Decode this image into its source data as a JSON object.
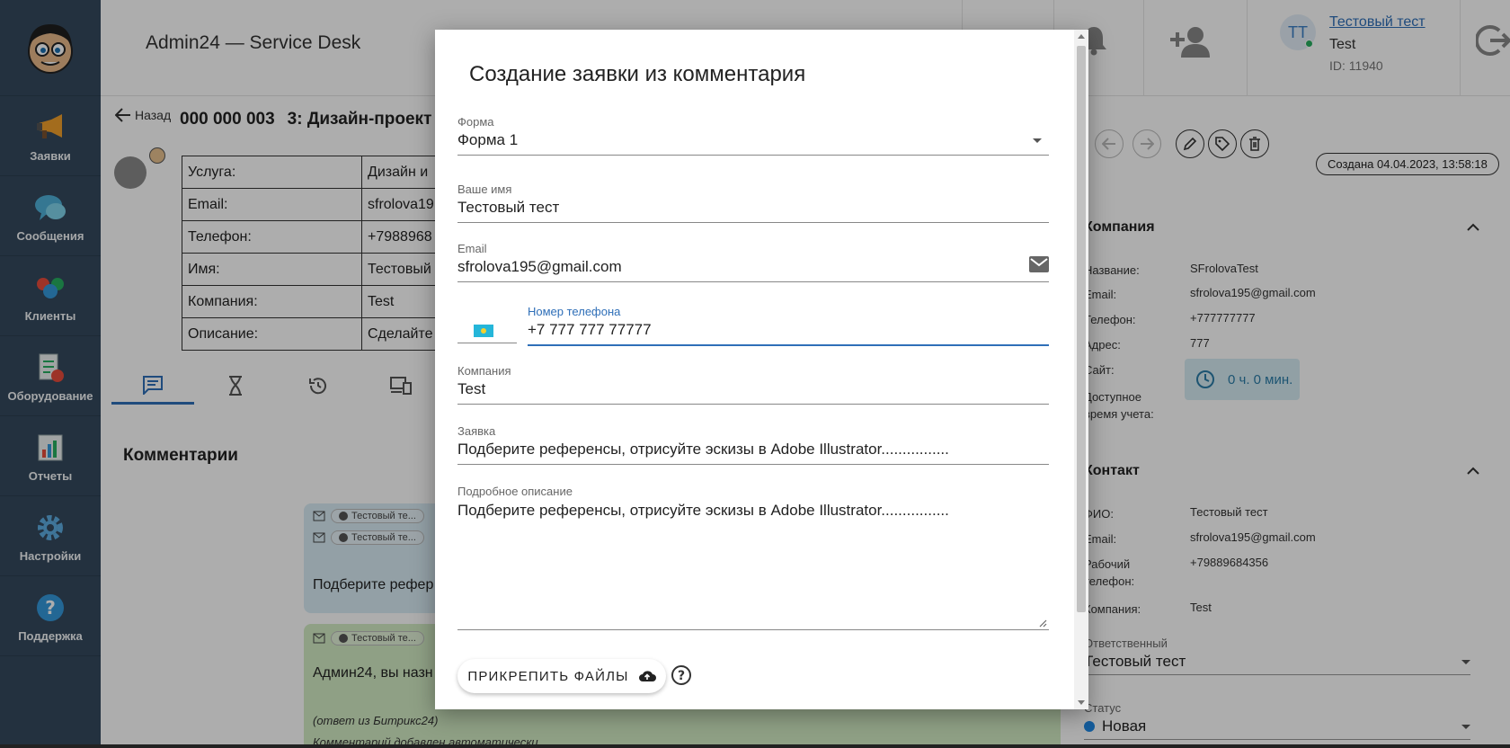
{
  "app": {
    "title": "Admin24 — Service Desk"
  },
  "sidebar": {
    "items": [
      {
        "label": "Заявки",
        "icon": "megaphone-icon"
      },
      {
        "label": "Сообщения",
        "icon": "chat-icon"
      },
      {
        "label": "Клиенты",
        "icon": "clients-icon"
      },
      {
        "label": "Оборудование",
        "icon": "equipment-icon"
      },
      {
        "label": "Отчеты",
        "icon": "reports-icon"
      },
      {
        "label": "Настройки",
        "icon": "gear-icon"
      },
      {
        "label": "Поддержка",
        "icon": "help-icon"
      }
    ]
  },
  "header": {
    "user_initials": "ТТ",
    "user_name": "Тестовый тест",
    "user_company": "Test",
    "user_id": "ID: 11940"
  },
  "ticket": {
    "back_label": "Назад",
    "number": "000 000 003",
    "title": "3: Дизайн-проект",
    "fields": [
      {
        "key": "Услуга:",
        "value": "Дизайн и"
      },
      {
        "key": "Email:",
        "value": "sfrolova19"
      },
      {
        "key": "Телефон:",
        "value": "+7988968"
      },
      {
        "key": "Имя:",
        "value": "Тестовый"
      },
      {
        "key": "Компания:",
        "value": "Test"
      },
      {
        "key": "Описание:",
        "value": "Сделайте"
      }
    ]
  },
  "comments": {
    "heading": "Комментарии",
    "c1": {
      "tag1": "Тестовый те...",
      "tag2": "Тестовый те...",
      "text": "Подберите рефер"
    },
    "c2": {
      "tag1": "Тестовый те...",
      "text": "Админ24, вы назн",
      "note1": "(ответ из Битрикс24)",
      "note2": "Комментарий добавлен автоматически"
    }
  },
  "right_panel": {
    "created": "Создана 04.04.2023, 13:58:18",
    "company": {
      "heading": "Компания",
      "rows": [
        {
          "key": "Название:",
          "value": "SFrolovaTest"
        },
        {
          "key": "Email:",
          "value": "sfrolova195@gmail.com"
        },
        {
          "key": "Телефон:",
          "value": "+777777777"
        },
        {
          "key": "Адрес:",
          "value": "777"
        },
        {
          "key": "Сайт:",
          "value": ""
        }
      ],
      "time_key_1": "Доступное",
      "time_key_2": "время учета:",
      "time_value": "0 ч. 0 мин."
    },
    "contact": {
      "heading": "Контакт",
      "fio_key": "ФИО:",
      "fio_value": "Тестовый тест",
      "email_key": "Email:",
      "email_value": "sfrolova195@gmail.com",
      "phone_key_1": "Рабочий",
      "phone_key_2": "телефон:",
      "phone_value": "+79889684356",
      "company_key": "Компания:",
      "company_value": "Test"
    },
    "responsible_label": "Ответственный",
    "responsible_value": "Тестовый тест",
    "status_label": "Статус",
    "status_value": "Новая"
  },
  "modal": {
    "title": "Создание заявки из комментария",
    "form_label": "Форма",
    "form_value": "Форма 1",
    "name_label": "Ваше имя",
    "name_value": "Тестовый тест",
    "email_label": "Email",
    "email_value": "sfrolova195@gmail.com",
    "phone_label": "Номер телефона",
    "phone_value": "+7 777 777 77777",
    "company_label": "Компания",
    "company_value": "Test",
    "request_label": "Заявка",
    "request_value": "Подберите референсы, отрисуйте эскизы в Adobe Illustrator................",
    "desc_label": "Подробное описание",
    "desc_value": "Подберите референсы, отрисуйте эскизы в Adobe Illustrator................",
    "attach_label": "ПРИКРЕПИТЬ ФАЙЛЫ"
  },
  "colors": {
    "sidebar": "#34495e",
    "accent": "#2f6fb8",
    "overlay": "rgba(0,0,0,0.32)"
  }
}
